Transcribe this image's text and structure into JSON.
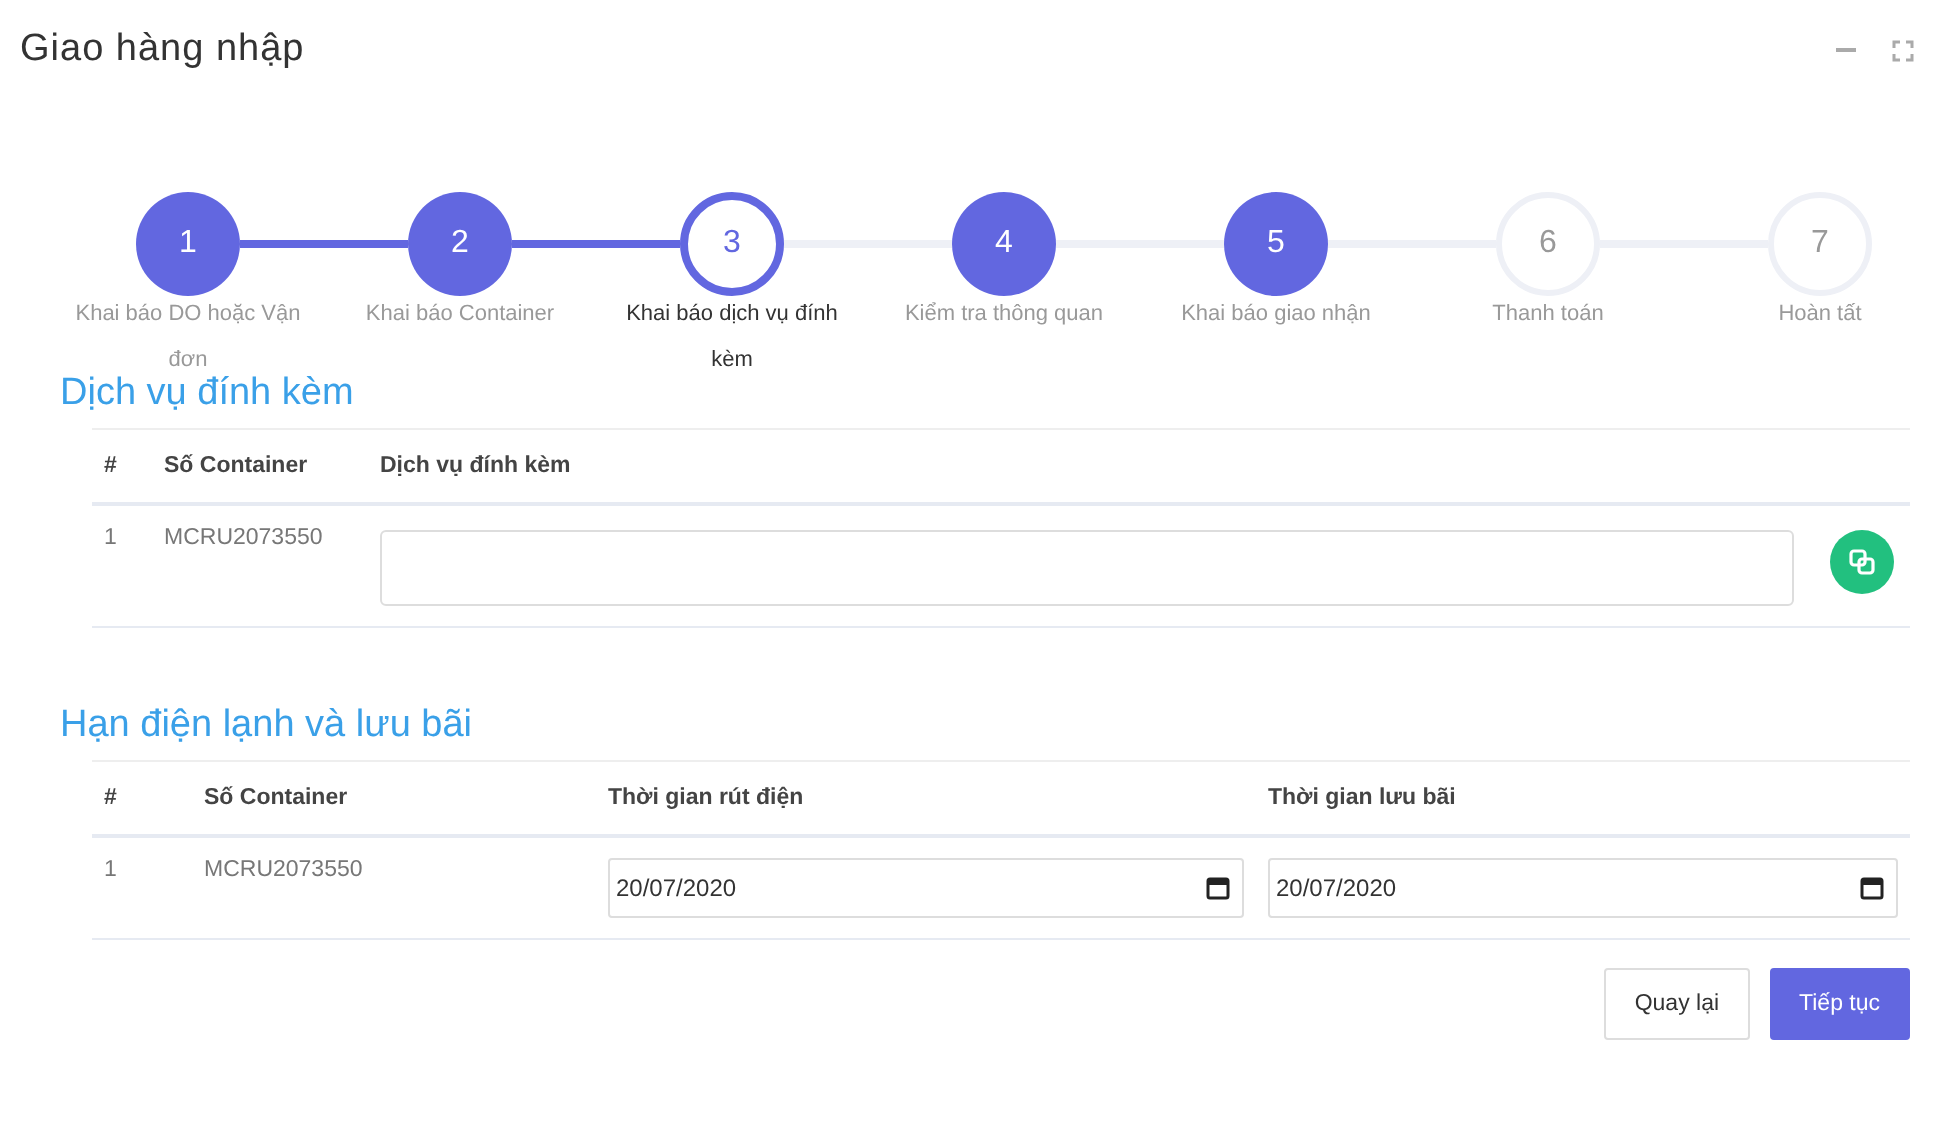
{
  "window": {
    "title": "Giao hàng nhập"
  },
  "steps": [
    {
      "number": "1",
      "label": "Khai báo DO hoặc Vận đơn",
      "selected": false,
      "filled": true,
      "completed": true
    },
    {
      "number": "2",
      "label": "Khai báo Container",
      "selected": false,
      "filled": true,
      "completed": true
    },
    {
      "number": "3",
      "label": "Khai báo dịch vụ đính kèm",
      "selected": true,
      "filled": false,
      "completed": false
    },
    {
      "number": "4",
      "label": "Kiểm tra thông quan",
      "selected": false,
      "filled": true,
      "completed": false
    },
    {
      "number": "5",
      "label": "Khai báo giao nhận",
      "selected": false,
      "filled": true,
      "completed": false
    },
    {
      "number": "6",
      "label": "Thanh toán",
      "selected": false,
      "filled": false,
      "completed": false
    },
    {
      "number": "7",
      "label": "Hoàn tất",
      "selected": false,
      "filled": false
    }
  ],
  "services": {
    "title": "Dịch vụ đính kèm",
    "columns": [
      "#",
      "Số Container",
      "Dịch vụ đính kèm"
    ],
    "rows": [
      {
        "index": "1",
        "container": "MCRU2073550"
      }
    ]
  },
  "reefer": {
    "title": "Hạn điện lạnh và lưu bãi",
    "columns": [
      "#",
      "Số Container",
      "Thời gian rút điện",
      "Thời gian lưu bãi"
    ],
    "rows": [
      {
        "index": "1",
        "container": "MCRU2073550",
        "unplug_date": "20/07/2020",
        "storage_date": "20/07/2020"
      }
    ]
  },
  "buttons": [
    {
      "label": "Quay lại",
      "kind": "secondary"
    },
    {
      "label": "Tiếp tục",
      "kind": "primary"
    }
  ]
}
